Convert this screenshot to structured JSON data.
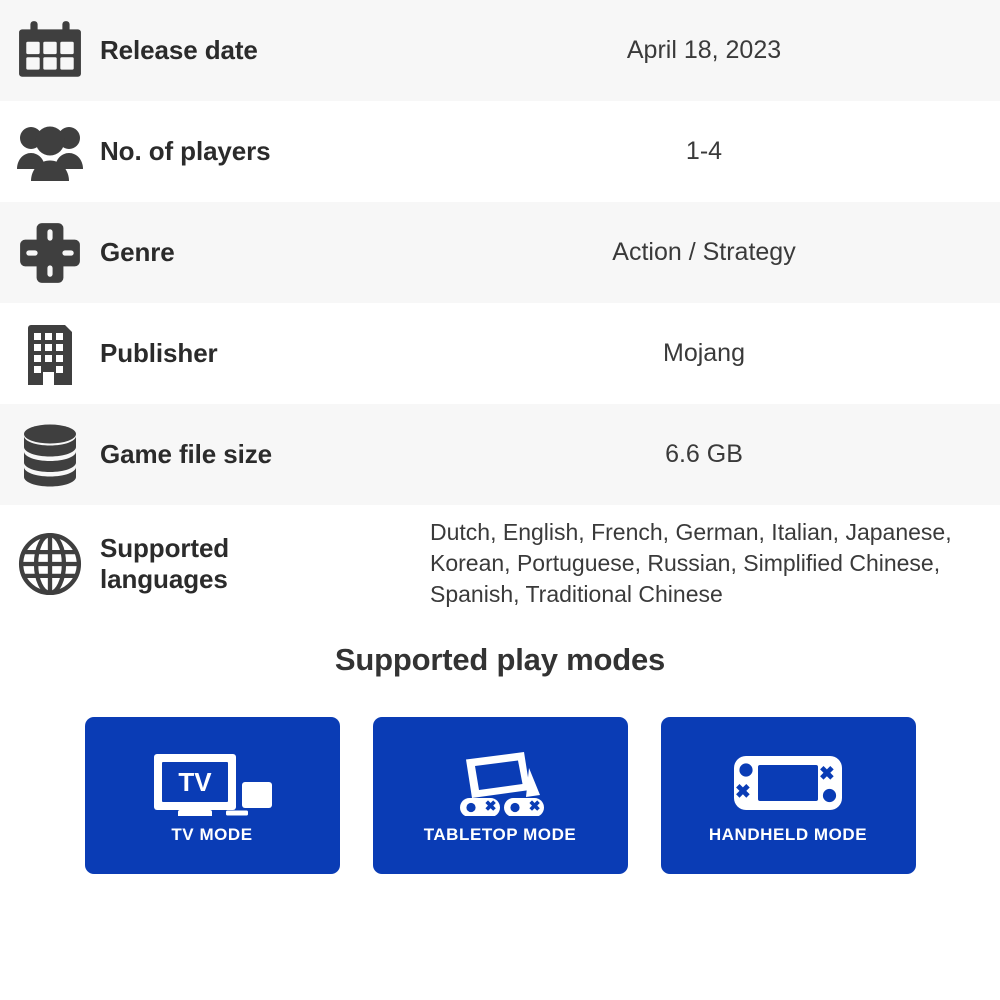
{
  "spec_table": {
    "rows": [
      {
        "icon": "calendar-icon",
        "label": "Release date",
        "value": "April 18, 2023"
      },
      {
        "icon": "players-group-icon",
        "label": "No. of players",
        "value": "1-4"
      },
      {
        "icon": "dpad-icon",
        "label": "Genre",
        "value": "Action / Strategy"
      },
      {
        "icon": "building-icon",
        "label": "Publisher",
        "value": "Mojang"
      },
      {
        "icon": "database-icon",
        "label": "Game file size",
        "value": "6.6 GB"
      },
      {
        "icon": "globe-icon",
        "label": "Supported languages",
        "value": "Dutch, English, French, German, Italian, Japanese, Korean, Portuguese, Russian, Simplified Chinese, Spanish, Traditional Chinese"
      }
    ]
  },
  "play_modes": {
    "title": "Supported play modes",
    "cards": [
      {
        "icon": "tv-mode-icon",
        "label": "TV MODE",
        "screen_text": "TV"
      },
      {
        "icon": "tabletop-mode-icon",
        "label": "TABLETOP MODE"
      },
      {
        "icon": "handheld-mode-icon",
        "label": "HANDHELD MODE"
      }
    ]
  },
  "colors": {
    "card_blue": "#0a3cb5",
    "icon_gray": "#3f3f3f",
    "label_dark": "#2b2b2b",
    "row_alt_bg": "#f7f7f7",
    "row_bg": "#ffffff"
  }
}
